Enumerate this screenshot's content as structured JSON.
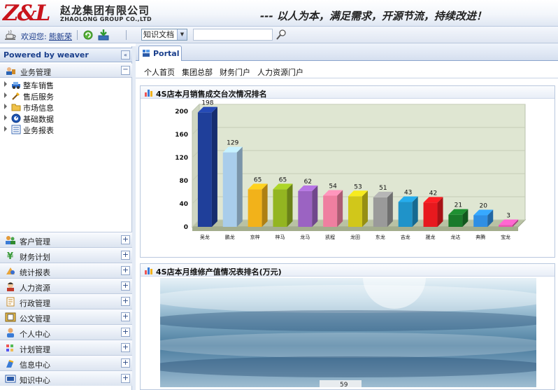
{
  "header": {
    "logo_text": "Z&L",
    "company_cn": "赵龙集团有限公司",
    "company_en": "ZHAOLONG GROUP CO.,LTD",
    "slogan": "---   以人为本，满足需求，开源节流，持续改进！"
  },
  "toolbar": {
    "welcome": "欢迎您:",
    "username": "熊新荣",
    "select_value": "知识文档",
    "search_placeholder": ""
  },
  "sidebar": {
    "powered_by": "Powered by weaver",
    "section_title": "业务管理",
    "tree": [
      {
        "label": "整车销售",
        "icon": "car-icon"
      },
      {
        "label": "售后服务",
        "icon": "wrench-icon"
      },
      {
        "label": "市场信息",
        "icon": "folder-icon"
      },
      {
        "label": "基础数据",
        "icon": "gauge-icon"
      },
      {
        "label": "业务报表",
        "icon": "report-icon"
      }
    ],
    "modules": [
      {
        "label": "客户管理",
        "icon": "customer-icon"
      },
      {
        "label": "财务计划",
        "icon": "finance-icon"
      },
      {
        "label": "统计报表",
        "icon": "stats-icon"
      },
      {
        "label": "人力资源",
        "icon": "person-icon"
      },
      {
        "label": "行政管理",
        "icon": "admin-icon"
      },
      {
        "label": "公文管理",
        "icon": "document-icon"
      },
      {
        "label": "个人中心",
        "icon": "user-icon"
      },
      {
        "label": "计划管理",
        "icon": "plan-icon"
      },
      {
        "label": "信息中心",
        "icon": "info-icon"
      },
      {
        "label": "知识中心",
        "icon": "knowledge-icon"
      }
    ]
  },
  "tabs": [
    {
      "label": "Portal"
    }
  ],
  "portal_nav": [
    "个人首页",
    "集团总部",
    "财务门户",
    "人力资源门户"
  ],
  "panels": {
    "sales_title": "4S店本月销售成交台次情况排名",
    "repair_title": "4S店本月维修产值情况表排名(万元)",
    "repair_partial_value": "59"
  },
  "colors": {
    "accent": "#1a3f8c",
    "logo_red": "#c8141c"
  },
  "chart_data": {
    "type": "bar",
    "title": "4S店本月销售成交台次情况排名",
    "categories": [
      "吴龙",
      "鹏龙",
      "京梓",
      "梓马",
      "龙马",
      "凯程",
      "龙田",
      "东龙",
      "吉龙",
      "晟龙",
      "龙达",
      "奔腾",
      "宝龙"
    ],
    "values": [
      198,
      129,
      65,
      65,
      62,
      54,
      53,
      51,
      43,
      42,
      21,
      20,
      3
    ],
    "bar_colors": [
      "#1f3f9a",
      "#a9cdeb",
      "#f2b21a",
      "#93b521",
      "#9b63c2",
      "#ef7fa0",
      "#d1c71a",
      "#9a9a9a",
      "#1f93c9",
      "#e8191e",
      "#1a7a2a",
      "#2f8fe4",
      "#e657b1"
    ],
    "yticks": [
      0,
      40,
      80,
      120,
      160,
      200
    ],
    "ylim": [
      0,
      200
    ],
    "grid": true,
    "xlabel": "",
    "ylabel": ""
  }
}
